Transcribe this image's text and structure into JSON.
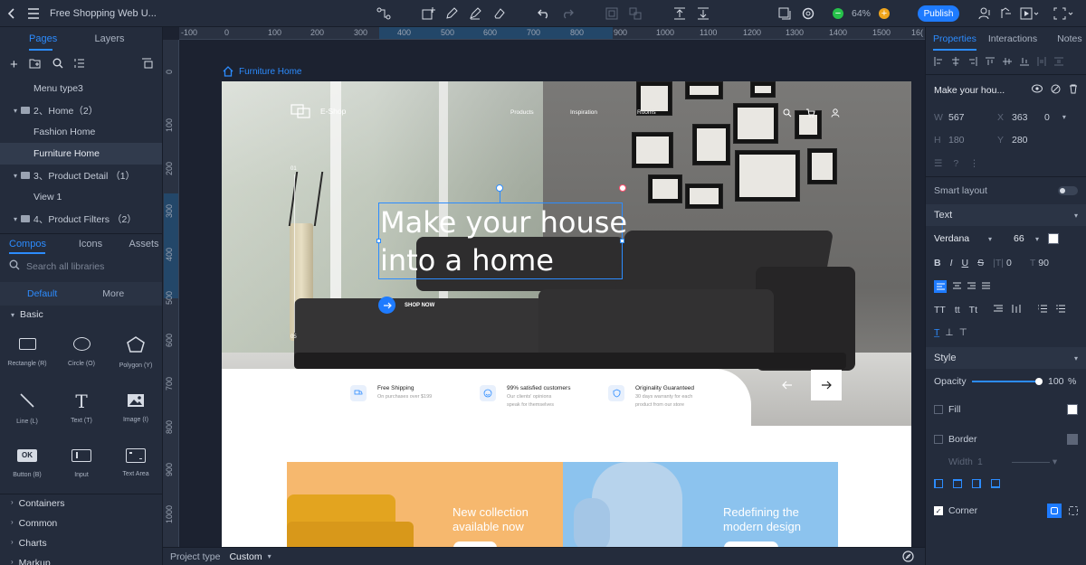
{
  "topbar": {
    "project_title": "Free Shopping Web U...",
    "zoom": "64%",
    "publish": "Publish"
  },
  "left": {
    "tabs": [
      "Pages",
      "Layers"
    ],
    "tree": [
      {
        "label": "Menu type3",
        "level": 2
      },
      {
        "label": "2、Home（2）",
        "level": 1
      },
      {
        "label": "Fashion Home",
        "level": 2
      },
      {
        "label": "Furniture Home",
        "level": 2,
        "selected": true
      },
      {
        "label": "3、Product  Detail （1）",
        "level": 1
      },
      {
        "label": "View 1",
        "level": 2
      },
      {
        "label": "4、Product Filters （2）",
        "level": 1
      }
    ],
    "lib_tabs": [
      "Compos",
      "Icons",
      "Assets"
    ],
    "search_placeholder": "Search all libraries",
    "sub_tabs": [
      "Default",
      "More"
    ],
    "basic_label": "Basic",
    "components": [
      {
        "name": "Rectangle (R)",
        "icon": "rectangle-icon"
      },
      {
        "name": "Circle (O)",
        "icon": "circle-icon"
      },
      {
        "name": "Polygon (Y)",
        "icon": "polygon-icon"
      },
      {
        "name": "Line (L)",
        "icon": "line-icon"
      },
      {
        "name": "Text (T)",
        "icon": "text-icon"
      },
      {
        "name": "Image (I)",
        "icon": "image-icon"
      },
      {
        "name": "Button (B)",
        "icon": "button-icon",
        "badge": "OK"
      },
      {
        "name": "Input",
        "icon": "input-icon"
      },
      {
        "name": "Text Area",
        "icon": "textarea-icon"
      }
    ],
    "categories": [
      "Containers",
      "Common",
      "Charts",
      "Markup"
    ]
  },
  "canvas": {
    "ruler_h": [
      "-100",
      "0",
      "100",
      "200",
      "300",
      "400",
      "500",
      "600",
      "700",
      "800",
      "900",
      "1000",
      "1100",
      "1200",
      "1300",
      "1400",
      "1500",
      "16("
    ],
    "ruler_v": [
      "0",
      "100",
      "200",
      "300",
      "400",
      "500",
      "600",
      "700",
      "800",
      "900",
      "1000",
      "1100"
    ],
    "page_label": "Furniture Home"
  },
  "site": {
    "logo": "E-Shop",
    "nav": [
      "Products",
      "Inspiration",
      "Rooms"
    ],
    "slide_start": "01",
    "slide_end": "05",
    "headline_line1": "Make your house",
    "headline_line2": "into a home",
    "cta": "SHOP NOW",
    "features": [
      {
        "title": "Free Shipping",
        "line1": "On purchases over $199",
        "line2": ""
      },
      {
        "title": "99% satisfied customers",
        "line1": "Our clients' opinions",
        "line2": "speak for themselves"
      },
      {
        "title": "Originality Guaranteed",
        "line1": "30 days warranty for each",
        "line2": "product from our store"
      }
    ],
    "cards": [
      {
        "line1": "New collection",
        "line2": "available now",
        "bg": "#f6b86e"
      },
      {
        "line1": "Redefining the",
        "line2": "modern design",
        "bg": "#8cc3ee"
      }
    ]
  },
  "right": {
    "tabs": [
      "Properties",
      "Interactions",
      "Notes"
    ],
    "element_name": "Make your hou...",
    "w": "567",
    "x": "363",
    "x_extra": "0",
    "h": "180",
    "y": "280",
    "smart_layout": "Smart layout",
    "text_section": "Text",
    "font": "Verdana",
    "font_size": "66",
    "letter_spacing": "0",
    "line_height": "90",
    "style_section": "Style",
    "opacity_label": "Opacity",
    "opacity_value": "100",
    "opacity_unit": "%",
    "fill_label": "Fill",
    "border_label": "Border",
    "width_label": "Width",
    "width_value": "1",
    "corner_label": "Corner"
  },
  "bottom": {
    "project_type_label": "Project type",
    "project_type_value": "Custom"
  },
  "colors": {
    "accent": "#2c8cff",
    "publish": "#1e7bff",
    "panel": "#242c3c"
  }
}
